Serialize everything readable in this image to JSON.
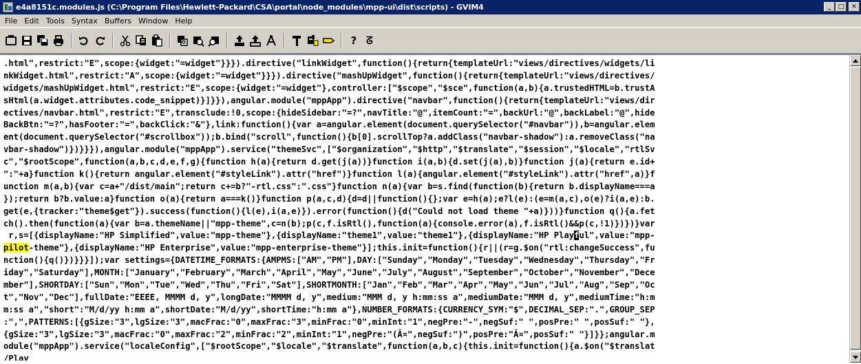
{
  "window": {
    "title": "e4a8151c.modules.js (C:\\Program Files\\Hewlett-Packard\\CSA\\portal\\node_modules\\mpp-ui\\dist\\scripts) - GVIM4",
    "buttons": {
      "minimize": "_",
      "maximize": "□",
      "close": "✕"
    }
  },
  "menubar": {
    "items": [
      "File",
      "Edit",
      "Tools",
      "Syntax",
      "Buffers",
      "Window",
      "Help"
    ]
  },
  "toolbar": {
    "groups": [
      [
        "open-icon",
        "save-icon",
        "save-all-icon",
        "print-icon"
      ],
      [
        "undo-icon",
        "redo-icon"
      ],
      [
        "cut-icon",
        "copy-icon",
        "paste-icon"
      ],
      [
        "replace-icon",
        "find-next-icon",
        "find-prev-icon"
      ],
      [
        "load-session-icon",
        "save-session-icon",
        "run-script-icon"
      ],
      [
        "make-icon",
        "shell-icon",
        "tags-icon"
      ],
      [
        "help-icon",
        "find-help-icon"
      ]
    ],
    "help_label": "?",
    "find_help_label": "ᘔ"
  },
  "editor": {
    "lines": [
      ".html\",restrict:\"E\",scope:{widget:\"=widget\"}}}).directive(\"linkWidget\",function(){return{templateUrl:\"views/directives/widgets/li",
      "nkWidget.html\",restrict:\"A\",scope:{widget:\"=widget\"}}}).directive(\"mashUpWidget\",function(){return{templateUrl:\"views/directives/",
      "widgets/mashUpWidget.html\",restrict:\"E\",scope:{widget:\"=widget\"},controller:[\"$scope\",\"$sce\",function(a,b){a.trustedHTML=b.trustA",
      "sHtml(a.widget.attributes.code_snippet)}]}}),angular.module(\"mppApp\").directive(\"navbar\",function(){return{templateUrl:\"views/dir",
      "ectives/navbar.html\",restrict:\"E\",transclude:!0,scope:{hideSidebar:\"=?\",navTitle:\"@\",itemCount:\"=\",backUrl:\"@\",backLabel:\"@\",hide",
      "BackBtn:\"=?\",hasFooter:\"=\",backClick:\"&\"},link:function(){var a=angular.element(document.querySelector(\"#navbar\")),b=angular.elem",
      "ent(document.querySelector(\"#scrollbox\"));b.bind(\"scroll\",function(){b[0].scrollTop?a.addClass(\"navbar-shadow\"):a.removeClass(\"na",
      "vbar-shadow\")})}}}),angular.module(\"mppApp\").service(\"themeSvc\",[\"$organization\",\"$http\",\"$translate\",\"$session\",\"$locale\",\"rtlSv",
      "c\",\"$rootScope\",function(a,b,c,d,e,f,g){function h(a){return d.get(j(a))}function i(a,b){d.set(j(a),b)}function j(a){return e.id+",
      "\":\"+a}function k(){return angular.element(\"#styleLink\").attr(\"href\")}function l(a){angular.element(\"#styleLink\").attr(\"href\",a)}f",
      "unction m(a,b){var c=a+\"/dist/main\";return c+=b?\"-rtl.css\":\".css\"}function n(a){var b=s.find(function(b){return b.displayName===a",
      "});return b?b.value:a}function o(a){return a===k()}function p(a,c,d){d=d||function(){};var e=h(a);e?l(e):(e=m(a,c),o(e)?i(a,e):b.",
      "get(e,{tracker:\"theme$get\"}).success(function(){l(e),i(a,e)}).error(function(){d(\"Could not load theme \"+a)}))}function q(){a.fet",
      "ch().then(function(a){var b=a.themeName||\"mpp-theme\",c=n(b);p(c,f.isRtl(),function(a){console.error(a),f.isRtl()&&p(c,!1)})})}var",
      " r,s=[{displayName:\"HP Simplified\",value:\"mpp-theme\"},{displayName:\"theme1\",value:\"theme1\"},{displayName:\"HP Playful\",value:\"mpp-",
      "pilot-theme\"},{displayName:\"HP Enterprise\",value:\"mpp-enterprise-theme\"}];this.init=function(){r||(r=g.$on(\"rtl:changeSuccess\",fu",
      "nction(){q()})}}}]);var settings={DATETIME_FORMATS:{AMPMS:[\"AM\",\"PM\"],DAY:[\"Sunday\",\"Monday\",\"Tuesday\",\"Wednesday\",\"Thursday\",\"Fr",
      "iday\",\"Saturday\"],MONTH:[\"January\",\"February\",\"March\",\"April\",\"May\",\"June\",\"July\",\"August\",\"September\",\"October\",\"November\",\"Dece",
      "mber\"],SHORTDAY:[\"Sun\",\"Mon\",\"Tue\",\"Wed\",\"Thu\",\"Fri\",\"Sat\"],SHORTMONTH:[\"Jan\",\"Feb\",\"Mar\",\"Apr\",\"May\",\"Jun\",\"Jul\",\"Aug\",\"Sep\",\"Oc",
      "t\",\"Nov\",\"Dec\"],fullDate:\"EEEE, MMMM d, y\",longDate:\"MMMM d, y\",medium:\"MMM d, y h:mm:ss a\",mediumDate:\"MMM d, y\",mediumTime:\"h:m",
      "m:ss a\",\"short\":\"M/d/yy h:mm a\",shortDate:\"M/d/yy\",shortTime:\"h:mm a\"},NUMBER_FORMATS:{CURRENCY_SYM:\"$\",DECIMAL_SEP:\".\",GROUP_SEP",
      ":\",\",PATTERNS:[{gSize:\"3\",lgSize:\"3\",macFrac:\"0\",maxFrac:\"3\",minFrac:\"0\",minInt:\"1\",negPre:\"-\",negSuf:\" \",posPre:\" \",posSuf:\" \"},",
      "{gSize:\"3\",lgSize:\"3\",macFrac:\"0\",maxFrac:\"2\",minFrac:\"2\",minInt:\"1\",negPre:\"(Â¤\",negSuf:\")\",posPre:\"Â¤\",posSuf:\" \"}]}};angular.m",
      "odule(\"mppApp\").service(\"localeConfig\",[\"$rootScope\",\"$locale\",\"$translate\",function(a,b,c){this.init=function(){a.$on(\"$translat",
      "/Play"
    ],
    "highlight": {
      "line": 15,
      "text": "pilot"
    },
    "cursor": {
      "line": 14,
      "char": "f"
    }
  }
}
